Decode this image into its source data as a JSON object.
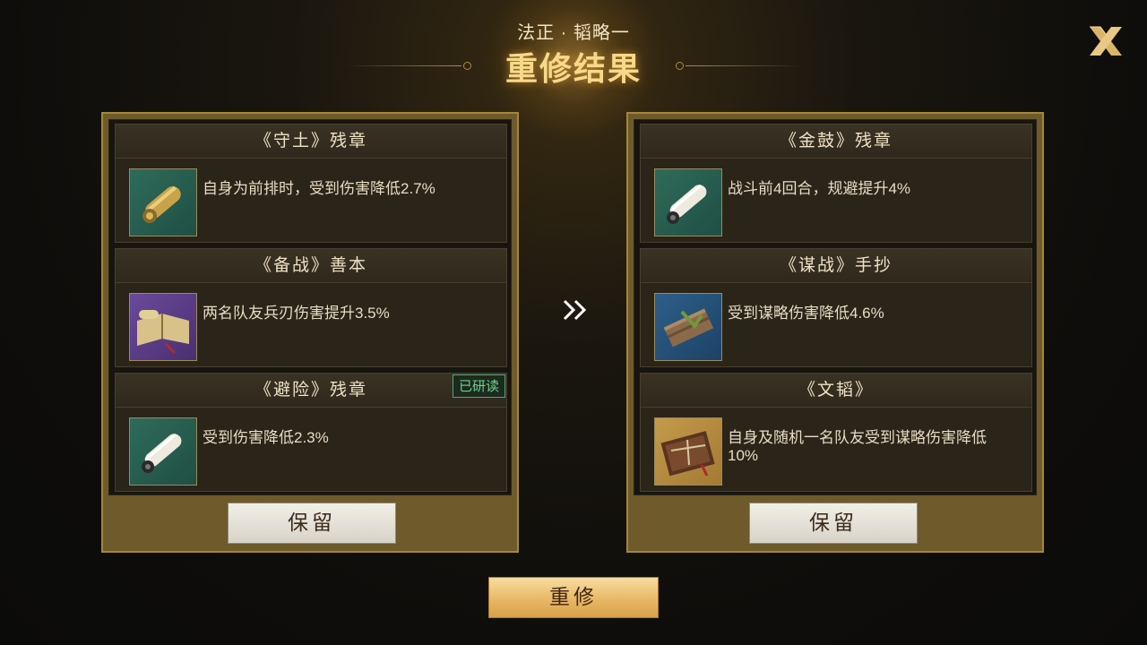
{
  "header": {
    "subtitle": "法正 · 韬略一",
    "title": "重修结果"
  },
  "icons": {
    "close": "close-x-icon",
    "arrow": "double-chevron-right-icon"
  },
  "colors": {
    "accent": "#f6d98a",
    "panel_border": "#a68637",
    "badge_green": "#6fd08c"
  },
  "left_panel": {
    "books": [
      {
        "name": "《守土》残章",
        "desc": "自身为前排时，受到伤害降低2.7%",
        "icon": "gold-scroll-icon",
        "badge": ""
      },
      {
        "name": "《备战》善本",
        "desc": "两名队友兵刃伤害提升3.5%",
        "icon": "open-book-icon",
        "badge": ""
      },
      {
        "name": "《避险》残章",
        "desc": "受到伤害降低2.3%",
        "icon": "white-scroll-icon",
        "badge": "已研读"
      }
    ],
    "keep_label": "保留"
  },
  "right_panel": {
    "books": [
      {
        "name": "《金鼓》残章",
        "desc": "战斗前4回合，规避提升4%",
        "icon": "white-scroll-icon",
        "badge": ""
      },
      {
        "name": "《谋战》手抄",
        "desc": "受到谋略伤害降低4.6%",
        "icon": "bamboo-bundle-icon",
        "badge": ""
      },
      {
        "name": "《文韬》",
        "desc": "自身及随机一名队友受到谋略伤害降低10%",
        "icon": "tied-book-icon",
        "badge": ""
      }
    ],
    "keep_label": "保留"
  },
  "rebuild_label": "重修"
}
